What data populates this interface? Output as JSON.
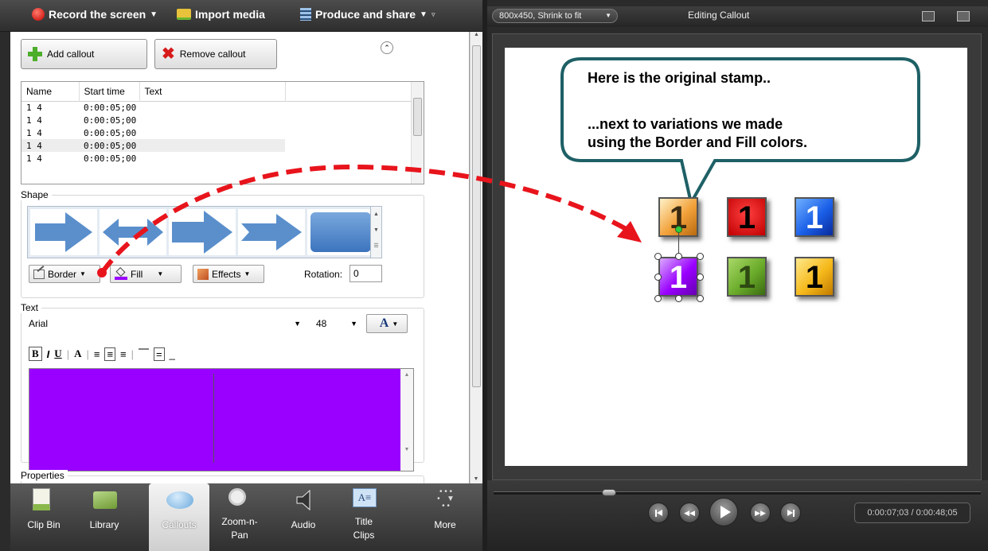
{
  "toolbar": {
    "record": "Record the screen",
    "import": "Import media",
    "produce": "Produce and share"
  },
  "callouts_panel": {
    "add_label": "Add callout",
    "remove_label": "Remove callout",
    "columns": [
      "Name",
      "Start time",
      "Text"
    ],
    "rows": [
      {
        "name": "1 4",
        "start": "0:00:05;00",
        "text": ""
      },
      {
        "name": "1 4",
        "start": "0:00:05;00",
        "text": ""
      },
      {
        "name": "1 4",
        "start": "0:00:05;00",
        "text": ""
      },
      {
        "name": "1 4",
        "start": "0:00:05;00",
        "text": ""
      },
      {
        "name": "1 4",
        "start": "0:00:05;00",
        "text": ""
      }
    ],
    "shape_label": "Shape",
    "border_label": "Border",
    "fill_label": "Fill",
    "effects_label": "Effects",
    "rotation_label": "Rotation:",
    "rotation_value": "0",
    "text_label": "Text",
    "font": "Arial",
    "font_size": "48",
    "properties_label": "Properties",
    "fill_color": "#9900ff"
  },
  "tabs": [
    {
      "label": "Clip Bin",
      "icon": "clip-bin-icon"
    },
    {
      "label": "Library",
      "icon": "library-icon"
    },
    {
      "label": "Callouts",
      "icon": "callout-bubble-icon"
    },
    {
      "label": "Zoom-n-\nPan",
      "icon": "magnifier-icon"
    },
    {
      "label": "Audio",
      "icon": "speaker-icon"
    },
    {
      "label": "Title\nClips",
      "icon": "title-clip-icon"
    },
    {
      "label": "More",
      "icon": "more-dots-icon"
    }
  ],
  "preview": {
    "size_dropdown": "800x450, Shrink to fit",
    "title": "Editing Callout",
    "callout_line1": "Here is the original stamp..",
    "callout_line2": "...next to variations we made",
    "callout_line3": "using the Border and Fill colors.",
    "stamps": [
      {
        "label": "1",
        "color": "#f2a13a",
        "text_color": "#3a2a10"
      },
      {
        "label": "1",
        "color": "#e81010",
        "text_color": "#000000"
      },
      {
        "label": "1",
        "color": "#1a5fe8",
        "text_color": "#ffffff"
      },
      {
        "label": "1",
        "color": "#9900ff",
        "text_color": "#ffffff"
      },
      {
        "label": "1",
        "color": "#6aab2a",
        "text_color": "#2e4a12"
      },
      {
        "label": "1",
        "color": "#f5b81a",
        "text_color": "#000000"
      }
    ],
    "time": "0:00:07;03 / 0:00:48;05",
    "callout_border": "#1e6066",
    "arrow_color": "#e8141c"
  }
}
